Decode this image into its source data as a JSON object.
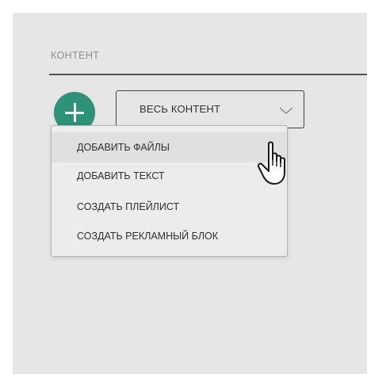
{
  "content_section": {
    "title": "КОНТЕНТ"
  },
  "add_button": {
    "icon": "plus-icon",
    "color": "#2e9278"
  },
  "filter_select": {
    "selected": "ВЕСЬ КОНТЕНТ",
    "icon": "chevron-down-icon"
  },
  "add_menu": {
    "items": [
      {
        "label": "ДОБАВИТЬ ФАЙЛЫ",
        "hovered": true
      },
      {
        "label": "ДОБАВИТЬ ТЕКСТ",
        "hovered": false
      },
      {
        "label": "СОЗДАТЬ ПЛЕЙЛИСТ",
        "hovered": false
      },
      {
        "label": "СОЗДАТЬ РЕКЛАМНЫЙ БЛОК",
        "hovered": false
      }
    ]
  },
  "pointer": {
    "icon": "hand-pointer-icon"
  }
}
